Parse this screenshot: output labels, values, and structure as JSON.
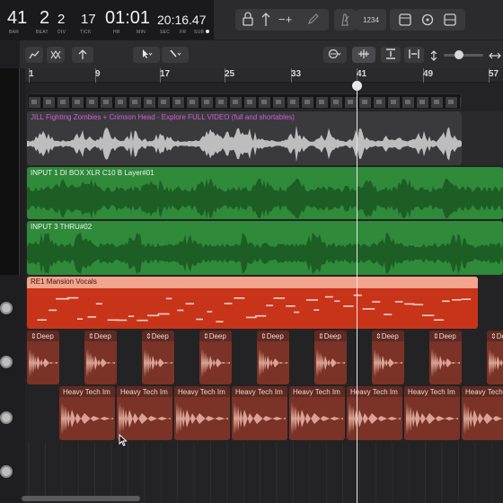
{
  "lcd": {
    "bar": "41",
    "beat": "2",
    "div": "2",
    "tick": "17",
    "time": "01:01",
    "subtime": "20:16.47",
    "captions": {
      "bar": "BAR",
      "beat": "BEAT",
      "div": "DIV",
      "tick": "TICK",
      "hr": "HR",
      "min": "MIN",
      "sec": "SEC",
      "fr": "FR",
      "sub": "SUB"
    }
  },
  "control_bar": {
    "count_in": "1234"
  },
  "ruler": {
    "markers": [
      "1",
      "9",
      "17",
      "25",
      "33",
      "41",
      "49",
      "57"
    ]
  },
  "tracks": {
    "video_title": "JILL Fighting Zombies + Crimson Head - Explore FULL VIDEO (full and shortables)",
    "input1": "INPUT 1 DI BOX XLR C10 B Layer#01",
    "input3": "INPUT 3 THRU#02",
    "vocals": "RE1 Mansion Vocals",
    "deep_label": "Deep",
    "heavy_label": "Heavy Tech Im"
  },
  "colors": {
    "video_region": "#3c3c3e",
    "video_label": "#d45bd9",
    "audio_green": "#2f8a3a",
    "audio_green_header": "#2c7c36",
    "midi_red": "#c8341a",
    "midi_header": "#f2a48c",
    "drum_region": "#7a3326",
    "drum_header": "#5e2a22"
  },
  "icons": {
    "pencil": "pencil-icon",
    "scissors": "scissors-icon",
    "pointer": "pointer-tool-icon",
    "metronome": "metronome-icon",
    "tuner": "tuner-icon"
  }
}
